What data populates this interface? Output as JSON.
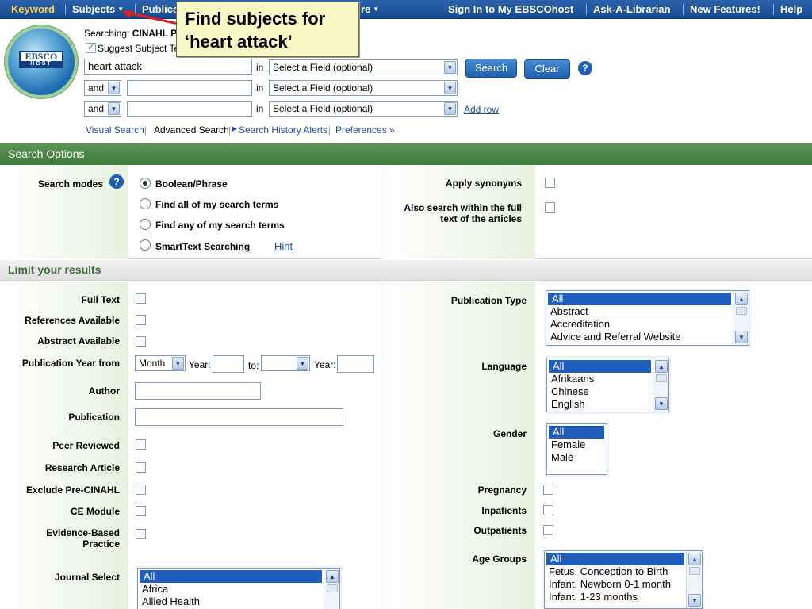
{
  "topnav": {
    "keyword": "Keyword",
    "subjects": "Subjects",
    "publications": "Publica",
    "more": "re",
    "sign_in": "Sign In to My EBSCOhost",
    "ask": "Ask-A-Librarian",
    "new_features": "New Features!",
    "help": "Help"
  },
  "callout": {
    "text": "Find subjects for\n‘heart attack’"
  },
  "logo": {
    "top": "EBSCO",
    "bottom": "HOST"
  },
  "header": {
    "searching_label": "Searching:",
    "searching_db": "CINAHL P",
    "suggest_label": "Suggest Subject Te",
    "rows": [
      {
        "bool": "",
        "value": "heart attack",
        "in": "in",
        "field": "Select a Field (optional)"
      },
      {
        "bool": "and",
        "value": "",
        "in": "in",
        "field": "Select a Field (optional)"
      },
      {
        "bool": "and",
        "value": "",
        "in": "in",
        "field": "Select a Field (optional)"
      }
    ],
    "search_btn": "Search",
    "clear_btn": "Clear",
    "help_glyph": "?",
    "add_row": "Add row",
    "links": {
      "visual": "Visual Search",
      "advanced": "Advanced Search",
      "history": "Search History Alerts",
      "prefs": "Preferences »"
    }
  },
  "search_options": {
    "title": "Search Options",
    "modes_label": "Search modes",
    "modes": [
      "Boolean/Phrase",
      "Find all of my search terms",
      "Find any of my search terms",
      "SmartText Searching"
    ],
    "hint": "Hint",
    "apply_synonyms": "Apply synonyms",
    "fulltext_l1": "Also search within the full",
    "fulltext_l2": "text of the articles"
  },
  "limits": {
    "title": "Limit your results",
    "full_text": "Full Text",
    "references": "References Available",
    "abstract": "Abstract Available",
    "pubyear": "Publication Year from",
    "month": "Month",
    "year": "Year:",
    "to": "to:",
    "year2": "Year:",
    "author": "Author",
    "publication": "Publication",
    "peer": "Peer Reviewed",
    "research": "Research Article",
    "exclude": "Exclude Pre-CINAHL",
    "ce": "CE Module",
    "ebp_l1": "Evidence-Based",
    "ebp_l2": "Practice",
    "journal": "Journal Select",
    "journal_opts": [
      "All",
      "Africa",
      "Allied Health"
    ],
    "pubtype": "Publication Type",
    "pubtype_opts": [
      "All",
      "Abstract",
      "Accreditation",
      "Advice and Referral Website"
    ],
    "language": "Language",
    "language_opts": [
      "All",
      "Afrikaans",
      "Chinese",
      "English"
    ],
    "gender": "Gender",
    "gender_opts": [
      "All",
      "Female",
      "Male"
    ],
    "pregnancy": "Pregnancy",
    "inpatients": "Inpatients",
    "outpatients": "Outpatients",
    "age": "Age Groups",
    "age_opts": [
      "All",
      "Fetus, Conception to Birth",
      "Infant, Newborn 0-1 month",
      "Infant, 1-23 months"
    ]
  },
  "colors": {
    "nav": "#1f56a0",
    "green_bar": "#4f8a4a",
    "callout_bg": "#f7f8c6",
    "arrow": "#e02020"
  }
}
